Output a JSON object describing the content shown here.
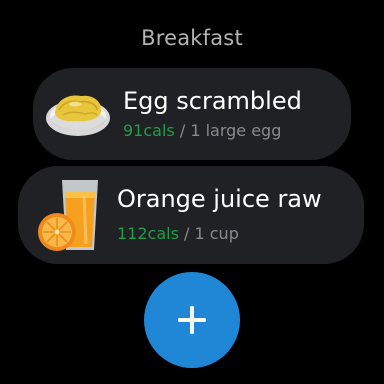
{
  "section": {
    "title": "Breakfast"
  },
  "items": [
    {
      "name": "Egg scrambled",
      "calories": "91cals",
      "separator": " / ",
      "serving": "1 large egg",
      "icon": "scrambled-egg-plate-icon"
    },
    {
      "name": "Orange juice raw",
      "calories": "112cals",
      "separator": " / ",
      "serving": "1 cup",
      "icon": "orange-juice-glass-icon"
    }
  ],
  "add_button": {
    "icon": "plus-icon"
  },
  "colors": {
    "background": "#000000",
    "card": "#202124",
    "calories": "#1e9e47",
    "fab": "#1f87d6",
    "title": "#b3b3b3"
  }
}
